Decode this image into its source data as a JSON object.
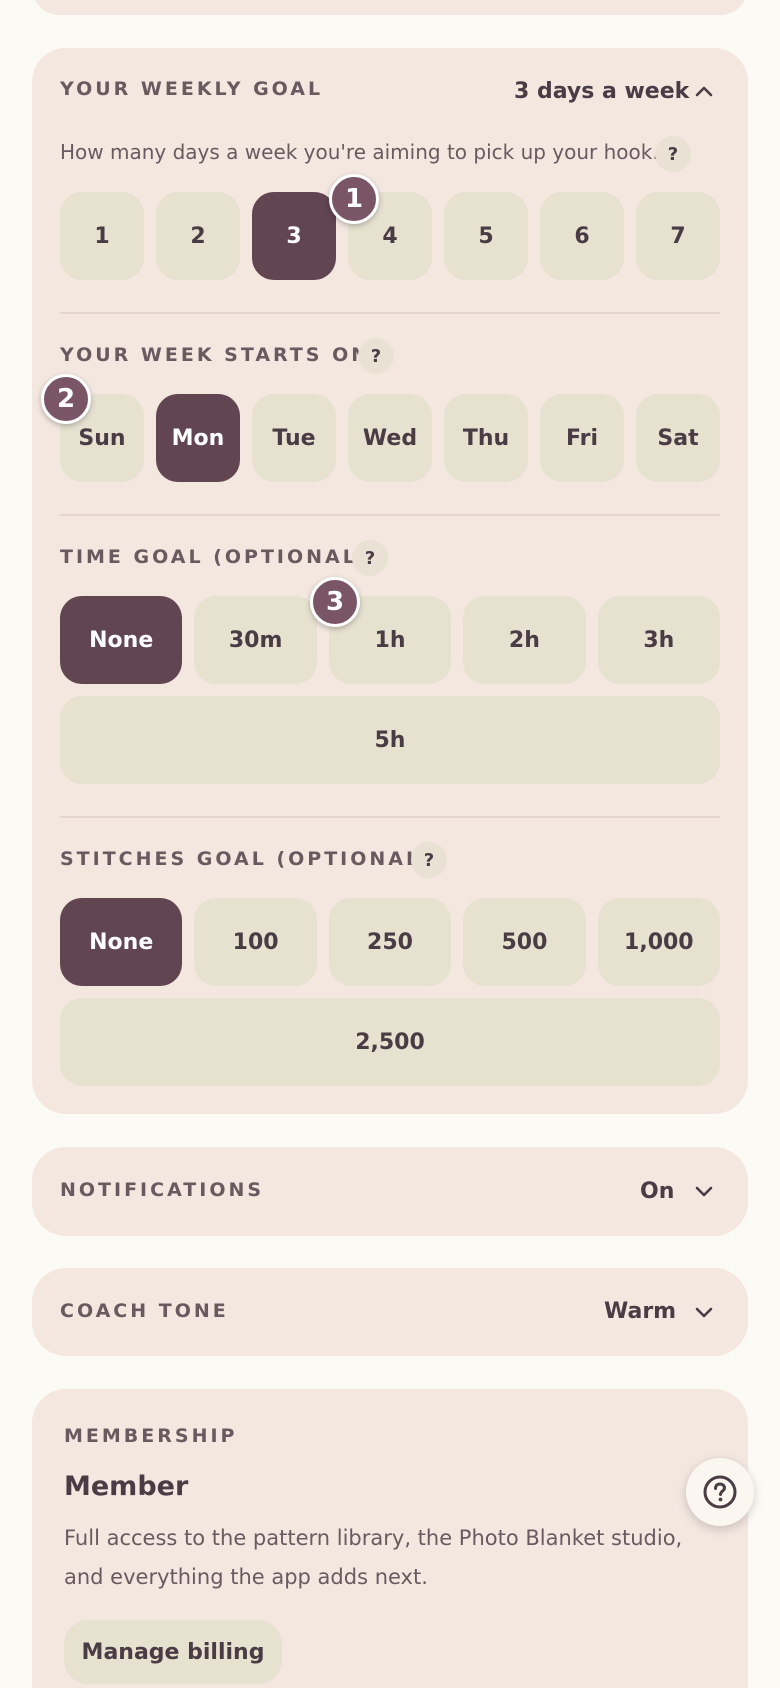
{
  "weekly_goal": {
    "label": "YOUR WEEKLY GOAL",
    "value": "3 days a week",
    "description": "How many days a week you're aiming to pick up your hook.",
    "help": "?",
    "options": [
      "1",
      "2",
      "3",
      "4",
      "5",
      "6",
      "7"
    ],
    "selected": "3",
    "badge": "1"
  },
  "week_start": {
    "label": "YOUR WEEK STARTS ON",
    "help": "?",
    "options": [
      "Sun",
      "Mon",
      "Tue",
      "Wed",
      "Thu",
      "Fri",
      "Sat"
    ],
    "selected": "Mon",
    "badge": "2"
  },
  "time_goal": {
    "label": "TIME GOAL (OPTIONAL)",
    "help": "?",
    "options": [
      "None",
      "30m",
      "1h",
      "2h",
      "3h"
    ],
    "wide_option": "5h",
    "selected": "None",
    "badge": "3"
  },
  "stitches_goal": {
    "label": "STITCHES GOAL (OPTIONAL)",
    "help": "?",
    "options": [
      "None",
      "100",
      "250",
      "500",
      "1,000"
    ],
    "wide_option": "2,500",
    "selected": "None"
  },
  "notifications": {
    "label": "NOTIFICATIONS",
    "value": "On"
  },
  "coach_tone": {
    "label": "COACH TONE",
    "value": "Warm"
  },
  "membership": {
    "label": "MEMBERSHIP",
    "title": "Member",
    "description": "Full access to the pattern library, the Photo Blanket studio, and everything the app adds next.",
    "billing_button": "Manage billing"
  },
  "icons": {
    "chevron_up": "chevron-up-icon",
    "chevron_down": "chevron-down-icon",
    "help_fab": "help-circle-icon"
  },
  "colors": {
    "background": "#fcfaf4",
    "card": "#f3e7e0",
    "option": "#e7e1d0",
    "selected": "#614551",
    "badge": "#7a5566",
    "text": "#4a3c44"
  }
}
